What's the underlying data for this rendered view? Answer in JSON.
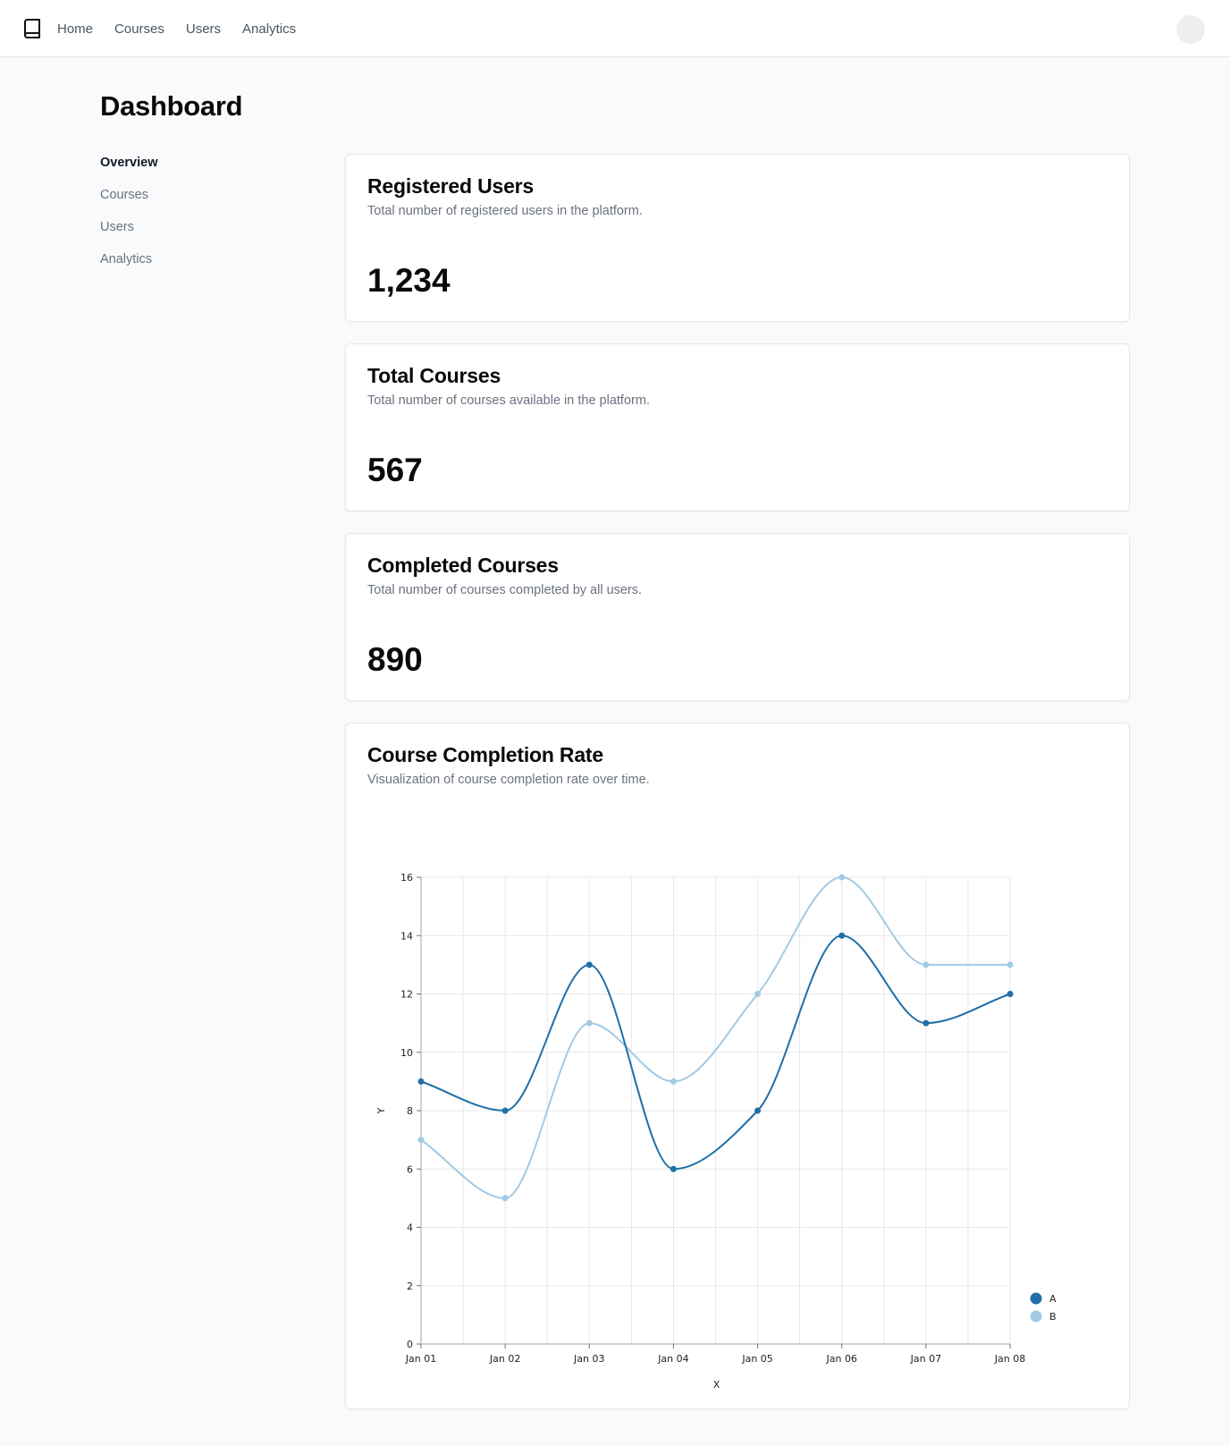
{
  "nav": {
    "logo_icon": "book-icon",
    "items": [
      {
        "label": "Home"
      },
      {
        "label": "Courses"
      },
      {
        "label": "Users"
      },
      {
        "label": "Analytics"
      }
    ]
  },
  "page": {
    "title": "Dashboard"
  },
  "sidebar": {
    "items": [
      {
        "label": "Overview",
        "active": true
      },
      {
        "label": "Courses",
        "active": false
      },
      {
        "label": "Users",
        "active": false
      },
      {
        "label": "Analytics",
        "active": false
      }
    ]
  },
  "cards": [
    {
      "title": "Registered Users",
      "description": "Total number of registered users in the platform.",
      "value": "1,234"
    },
    {
      "title": "Total Courses",
      "description": "Total number of courses available in the platform.",
      "value": "567"
    },
    {
      "title": "Completed Courses",
      "description": "Total number of courses completed by all users.",
      "value": "890"
    }
  ],
  "chart_card": {
    "title": "Course Completion Rate",
    "description": "Visualization of course completion rate over time."
  },
  "chart_data": {
    "type": "line",
    "categories": [
      "Jan 01",
      "Jan 02",
      "Jan 03",
      "Jan 04",
      "Jan 05",
      "Jan 06",
      "Jan 07",
      "Jan 08"
    ],
    "series": [
      {
        "name": "A",
        "color": "#1f6fa8",
        "values": [
          9,
          8,
          13,
          6,
          8,
          14,
          11,
          12
        ]
      },
      {
        "name": "B",
        "color": "#a2cae3",
        "values": [
          7,
          5,
          11,
          9,
          12,
          16,
          13,
          13
        ]
      }
    ],
    "xlabel": "X",
    "ylabel": "Y",
    "ylim": [
      0,
      16
    ],
    "yticks": [
      0,
      2,
      4,
      6,
      8,
      10,
      12,
      14,
      16
    ],
    "grid": true,
    "legend_position": "bottom-right"
  }
}
